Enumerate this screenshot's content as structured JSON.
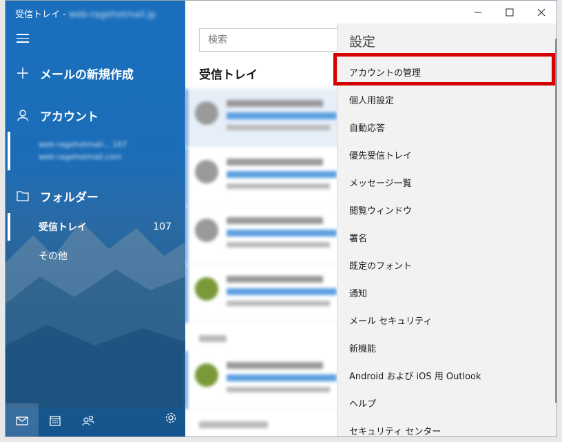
{
  "window": {
    "title": "受信トレイ - ",
    "title_account_blurred": "web-ragehotmail.jp"
  },
  "sidebar": {
    "new_mail_label": "メールの新規作成",
    "accounts_label": "アカウント",
    "account_line1": "web-ragehotmail... 107",
    "account_line2": "web-ragehotmail.com",
    "folders_label": "フォルダー",
    "folders": [
      {
        "name": "受信トレイ",
        "count": "107"
      },
      {
        "name": "その他",
        "count": ""
      }
    ],
    "bottom_icons": [
      "mail-icon",
      "calendar-icon",
      "people-icon",
      "settings-gear-icon"
    ]
  },
  "list": {
    "search_placeholder": "検索",
    "title": "受信トレイ"
  },
  "settings": {
    "title": "設定",
    "items": [
      "アカウントの管理",
      "個人用設定",
      "自動応答",
      "優先受信トレイ",
      "メッセージ一覧",
      "閲覧ウィンドウ",
      "署名",
      "既定のフォント",
      "通知",
      "メール セキュリティ",
      "新機能",
      "Android および iOS 用 Outlook",
      "ヘルプ",
      "セキュリティ センター"
    ],
    "highlight_color": "#d60000"
  },
  "colors": {
    "sidebar_blue": "#1a6fbd",
    "accent": "#2a74c5"
  }
}
